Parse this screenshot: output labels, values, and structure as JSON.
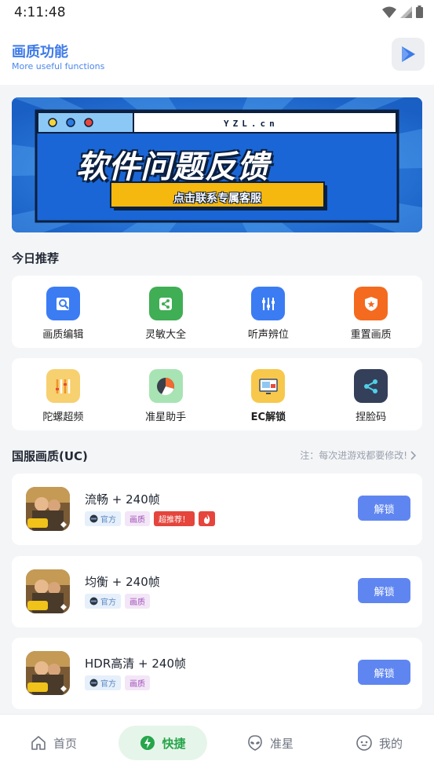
{
  "status_bar": {
    "time": "4:11:48"
  },
  "header": {
    "title": "画质功能",
    "subtitle": "More useful functions"
  },
  "banner": {
    "site": "YZL.cn",
    "headline": "软件问题反馈",
    "cta": "点击联系专属客服"
  },
  "today": {
    "title": "今日推荐",
    "row1": [
      {
        "label": "画质编辑",
        "icon": "image-edit-icon",
        "color": "#3b7cf3"
      },
      {
        "label": "灵敏大全",
        "icon": "share-icon",
        "color": "#3fae54"
      },
      {
        "label": "听声辨位",
        "icon": "sliders-icon",
        "color": "#3b7cf3"
      },
      {
        "label": "重置画质",
        "icon": "shield-star-icon",
        "color": "#f46a1f"
      }
    ],
    "row2": [
      {
        "label": "陀螺超频",
        "icon": "gyro-bars-icon",
        "color": "#f7d070"
      },
      {
        "label": "准星助手",
        "icon": "pie-chart-icon",
        "color": "#a8e3b4"
      },
      {
        "label": "EC解锁",
        "icon": "monitor-icon",
        "color": "#f7c84c"
      },
      {
        "label": "捏脸码",
        "icon": "share-nodes-icon",
        "color": "#34405a"
      }
    ]
  },
  "uc": {
    "title": "国服画质(UC)",
    "note": "注：每次进游戏都要修改!",
    "items": [
      {
        "name": "流畅 + 240帧",
        "tag_official": "官方",
        "tag_quality": "画质",
        "tag_hot": "超推荐！",
        "button": "解锁"
      },
      {
        "name": "均衡 + 240帧",
        "tag_official": "官方",
        "tag_quality": "画质",
        "button": "解锁"
      },
      {
        "name": "HDR高清 + 240帧",
        "tag_official": "官方",
        "tag_quality": "画质",
        "button": "解锁"
      }
    ]
  },
  "bottom_nav": [
    {
      "label": "首页",
      "icon": "home-icon"
    },
    {
      "label": "快捷",
      "icon": "lightning-icon",
      "active": true
    },
    {
      "label": "准星",
      "icon": "alien-icon"
    },
    {
      "label": "我的",
      "icon": "smiley-icon"
    }
  ]
}
